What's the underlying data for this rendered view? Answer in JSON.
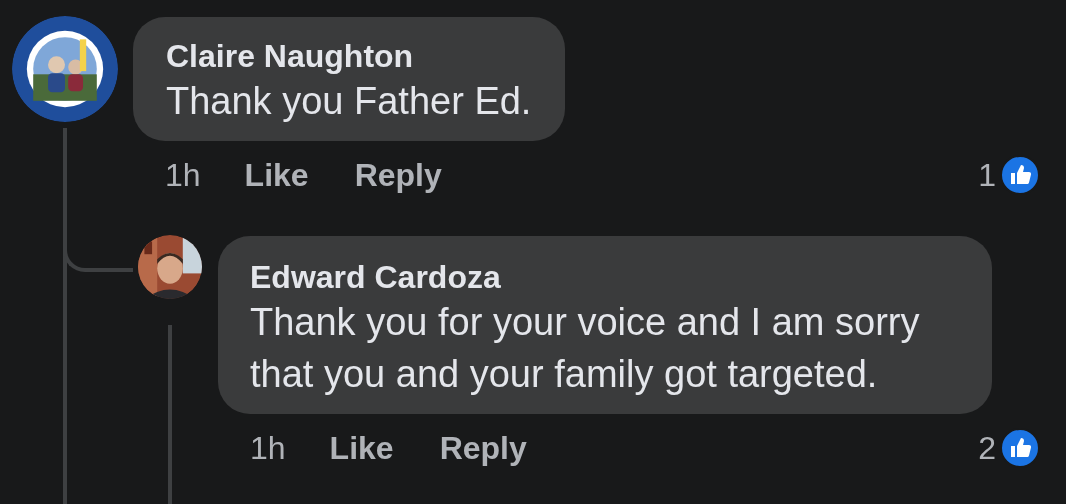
{
  "comments": [
    {
      "author": "Claire Naughton",
      "text": "Thank you Father Ed.",
      "time": "1h",
      "actions": [
        "Like",
        "Reply"
      ],
      "reaction_count": "1",
      "avatar": {
        "kind": "picture"
      },
      "children": [
        {
          "author": "Edward Cardoza",
          "text": "Thank you for your voice and I am sorry that you and your family got targeted.",
          "time": "1h",
          "actions": [
            "Like",
            "Reply"
          ],
          "reaction_count": "2",
          "avatar": {
            "kind": "picture"
          }
        }
      ]
    }
  ]
}
